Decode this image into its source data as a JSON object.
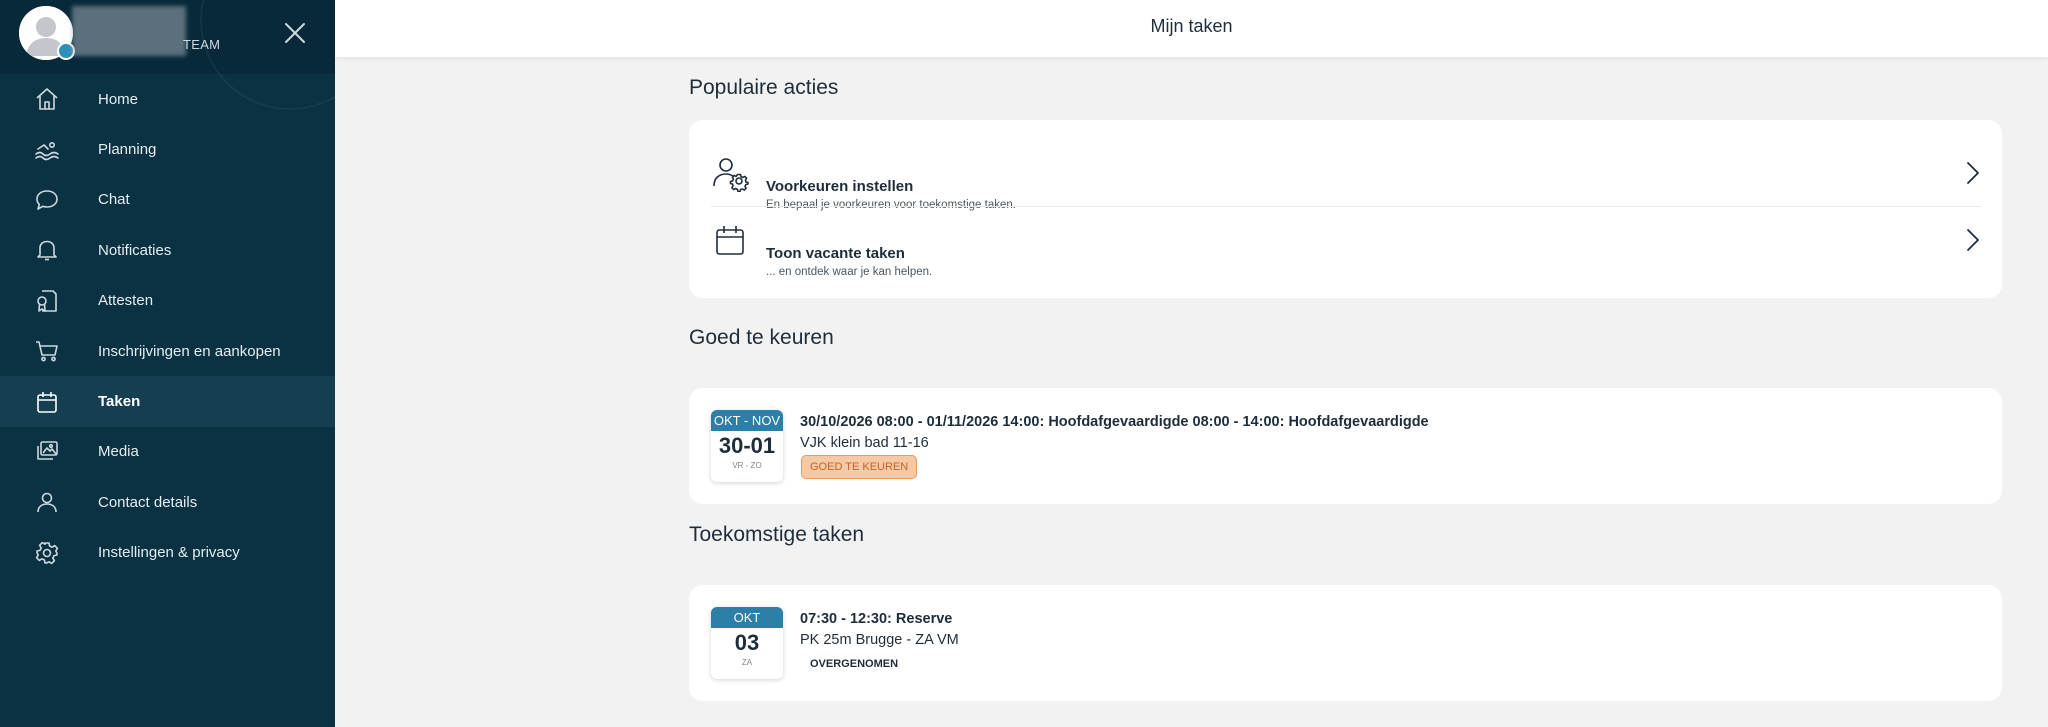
{
  "sidebar": {
    "team_label": "TEAM",
    "items": [
      {
        "label": "Home",
        "icon": "home-icon"
      },
      {
        "label": "Planning",
        "icon": "swimmer-icon"
      },
      {
        "label": "Chat",
        "icon": "chat-icon"
      },
      {
        "label": "Notificaties",
        "icon": "bell-icon"
      },
      {
        "label": "Attesten",
        "icon": "certificate-icon"
      },
      {
        "label": "Inschrijvingen en aankopen",
        "icon": "cart-icon"
      },
      {
        "label": "Taken",
        "icon": "calendar-icon",
        "active": true
      },
      {
        "label": "Media",
        "icon": "media-icon"
      },
      {
        "label": "Contact details",
        "icon": "person-icon"
      },
      {
        "label": "Instellingen & privacy",
        "icon": "gear-icon"
      }
    ]
  },
  "header": {
    "title": "Mijn taken"
  },
  "popular": {
    "title": "Populaire acties",
    "actions": [
      {
        "title": "Voorkeuren instellen",
        "subtitle": "En bepaal je voorkeuren voor toekomstige taken.",
        "icon": "user-settings-icon"
      },
      {
        "title": "Toon vacante taken",
        "subtitle": "... en ontdek waar je kan helpen.",
        "icon": "calendar-icon"
      }
    ]
  },
  "approve": {
    "title": "Goed te keuren",
    "task": {
      "month": "OKT - NOV",
      "day": "30-01",
      "weekday": "VR - ZO",
      "title": "30/10/2026 08:00 - 01/11/2026 14:00: Hoofdafgevaardigde 08:00 - 14:00: Hoofdafgevaardigde",
      "location": "VJK klein bad 11-16",
      "status": "GOED TE KEUREN"
    }
  },
  "upcoming": {
    "title": "Toekomstige taken",
    "task": {
      "month": "OKT",
      "day": "03",
      "weekday": "ZA",
      "title": "07:30 - 12:30: Reserve",
      "location": "PK 25m Brugge - ZA VM",
      "status": "OVERGENOMEN"
    }
  },
  "colors": {
    "sidebar_bg": "#0a3243",
    "date_header": "#2b7fa8",
    "status_orange_bg": "#f6c9a4",
    "status_orange_text": "#c4622a"
  }
}
